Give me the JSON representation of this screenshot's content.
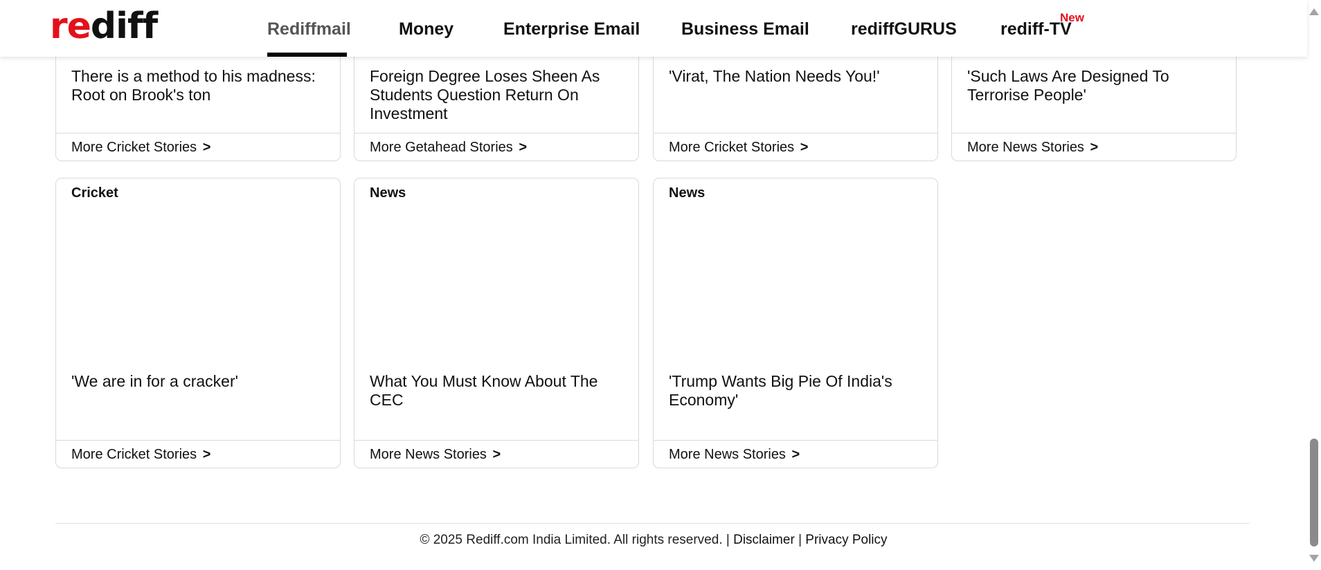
{
  "header": {
    "logo": {
      "part1": "re",
      "part2": "diff"
    },
    "nav": [
      {
        "label": "Rediffmail",
        "active": true
      },
      {
        "label": "Money"
      },
      {
        "label": "Enterprise Email"
      },
      {
        "label": "Business Email"
      },
      {
        "label": "rediffGURUS"
      },
      {
        "label": "rediff-TV",
        "badge": "New"
      }
    ]
  },
  "cards_row1": [
    {
      "title": "There is a method to his madness: Root on Brook's ton",
      "more": "More Cricket Stories"
    },
    {
      "title": "Foreign Degree Loses Sheen As Students Question Return On Investment",
      "more": "More Getahead Stories"
    },
    {
      "title": "'Virat, The Nation Needs You!'",
      "more": "More Cricket Stories"
    },
    {
      "title": "'Such Laws Are Designed To Terrorise People'",
      "more": "More News Stories"
    }
  ],
  "cards_row2": [
    {
      "category": "Cricket",
      "title": "'We are in for a cracker'",
      "more": "More Cricket Stories"
    },
    {
      "category": "News",
      "title": "What You Must Know About The CEC",
      "more": "More News Stories"
    },
    {
      "category": "News",
      "title": "'Trump Wants Big Pie Of India's Economy'",
      "more": "More News Stories"
    }
  ],
  "more_arrow": ">",
  "footer": {
    "copyright": "© 2025 Rediff.com India Limited. All rights reserved. |",
    "disclaimer": "Disclaimer",
    "separator": "|",
    "privacy": "Privacy Policy"
  },
  "colors": {
    "brand_red": "#e3111b",
    "text": "#111111",
    "border": "#d9d9d9"
  }
}
